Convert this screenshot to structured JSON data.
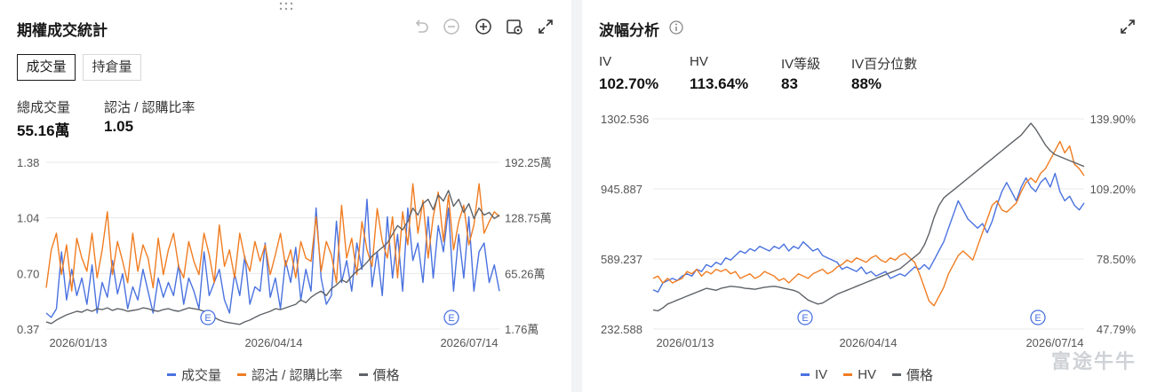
{
  "left": {
    "title": "期權成交統計",
    "tabs": [
      {
        "label": "成交量",
        "active": true
      },
      {
        "label": "持倉量",
        "active": false
      }
    ],
    "stats": [
      {
        "label": "總成交量",
        "value": "55.16萬"
      },
      {
        "label": "認沽 / 認購比率",
        "value": "1.05"
      }
    ],
    "toolbar_icons": [
      "undo-icon",
      "zoom-out-icon",
      "zoom-in-icon",
      "settings-icon",
      "expand-icon"
    ],
    "legend": [
      {
        "label": "成交量",
        "color": "#4a72e0"
      },
      {
        "label": "認沽 / 認購比率",
        "color": "#f07d22"
      },
      {
        "label": "價格",
        "color": "#5f6368"
      }
    ]
  },
  "right": {
    "title": "波幅分析",
    "metrics": [
      {
        "label": "IV",
        "value": "102.70%"
      },
      {
        "label": "HV",
        "value": "113.64%"
      },
      {
        "label": "IV等級",
        "value": "83"
      },
      {
        "label": "IV百分位數",
        "value": "88%"
      }
    ],
    "legend": [
      {
        "label": "IV",
        "color": "#4a72e0"
      },
      {
        "label": "HV",
        "color": "#f07d22"
      },
      {
        "label": "價格",
        "color": "#5f6368"
      }
    ],
    "watermark": "富途牛牛"
  },
  "chart_data": [
    {
      "type": "line",
      "title": "期權成交統計",
      "left_axis_ticks": [
        "1.38",
        "1.04",
        "0.70",
        "0.37"
      ],
      "right_axis_ticks": [
        "192.25萬",
        "128.75萬",
        "65.26萬",
        "1.76萬"
      ],
      "x_ticks": [
        "2026/01/13",
        "2026/04/14",
        "2026/07/14"
      ],
      "event_markers": [
        "E",
        "E"
      ],
      "ylim_left": [
        0.37,
        1.38
      ],
      "ylim_right": [
        1.76,
        192.25
      ],
      "series": [
        {
          "name": "成交量",
          "axis": "right",
          "color": "#4a72e0",
          "values": [
            20,
            15,
            25,
            90,
            35,
            70,
            40,
            60,
            30,
            75,
            20,
            55,
            38,
            80,
            42,
            65,
            25,
            50,
            35,
            70,
            45,
            20,
            60,
            38,
            55,
            40,
            75,
            30,
            60,
            45,
            25,
            90,
            40,
            55,
            70,
            35,
            20,
            65,
            40,
            85,
            30,
            50,
            45,
            100,
            38,
            60,
            25,
            80,
            55,
            95,
            35,
            70,
            45,
            140,
            60,
            30,
            40,
            125,
            55,
            80,
            45,
            100,
            70,
            150,
            50,
            90,
            40,
            130,
            60,
            110,
            45,
            140,
            80,
            100,
            55,
            130,
            60,
            120,
            90,
            140,
            45,
            110,
            60,
            130,
            45,
            90,
            100,
            55,
            75,
            45
          ]
        },
        {
          "name": "認沽 / 認購比率",
          "axis": "left",
          "color": "#f07d22",
          "values": [
            0.62,
            0.85,
            0.95,
            0.7,
            0.88,
            0.6,
            0.92,
            0.8,
            0.72,
            0.95,
            0.68,
            0.85,
            1.08,
            0.7,
            0.9,
            0.78,
            0.65,
            0.95,
            0.72,
            0.88,
            0.8,
            0.62,
            0.92,
            0.7,
            0.85,
            0.95,
            0.75,
            0.68,
            0.9,
            0.78,
            0.7,
            0.95,
            0.82,
            0.65,
            1.0,
            0.75,
            0.85,
            0.68,
            0.95,
            0.8,
            0.72,
            0.9,
            0.78,
            0.88,
            0.7,
            0.82,
            0.95,
            0.75,
            0.85,
            0.68,
            0.9,
            0.8,
            0.78,
            1.05,
            0.72,
            0.9,
            0.82,
            0.65,
            1.12,
            0.8,
            0.92,
            0.7,
            1.02,
            0.85,
            0.75,
            1.1,
            0.9,
            0.8,
            1.05,
            0.68,
            1.08,
            0.88,
            1.25,
            0.95,
            1.15,
            0.8,
            1.05,
            1.2,
            0.9,
            1.18,
            0.85,
            1.02,
            1.12,
            0.88,
            1.0,
            1.25,
            0.95,
            1.02,
            1.08,
            1.05
          ]
        },
        {
          "name": "價格",
          "axis": "right",
          "color": "#5f6368",
          "values": [
            10,
            8,
            12,
            15,
            18,
            20,
            22,
            21,
            24,
            22,
            25,
            24,
            26,
            23,
            25,
            24,
            22,
            23,
            24,
            26,
            25,
            23,
            22,
            24,
            25,
            23,
            22,
            24,
            26,
            25,
            24,
            22,
            18,
            15,
            12,
            10,
            9,
            8,
            7,
            10,
            12,
            15,
            18,
            20,
            22,
            25,
            24,
            26,
            28,
            30,
            35,
            32,
            38,
            42,
            45,
            40,
            48,
            52,
            58,
            55,
            62,
            68,
            72,
            78,
            85,
            90,
            95,
            100,
            110,
            120,
            115,
            125,
            140,
            132,
            145,
            150,
            138,
            155,
            148,
            160,
            142,
            150,
            135,
            145,
            128,
            140,
            132,
            135,
            128,
            132
          ]
        }
      ]
    },
    {
      "type": "line",
      "title": "波幅分析",
      "left_axis_ticks": [
        "1302.536",
        "945.887",
        "589.237",
        "232.588"
      ],
      "right_axis_ticks": [
        "139.90%",
        "109.20%",
        "78.50%",
        "47.79%"
      ],
      "x_ticks": [
        "2026/01/13",
        "2026/04/14",
        "2026/07/14"
      ],
      "event_markers": [
        "E",
        "E"
      ],
      "ylim_left": [
        232.588,
        1302.536
      ],
      "ylim_right": [
        47.79,
        139.9
      ],
      "series": [
        {
          "name": "IV",
          "axis": "right",
          "color": "#4a72e0",
          "values": [
            65,
            64,
            68,
            69,
            70,
            69,
            71,
            72,
            71,
            74,
            73,
            76,
            75,
            77,
            76,
            79,
            78,
            80,
            82,
            81,
            83,
            82,
            84,
            83,
            82,
            84,
            83,
            85,
            82,
            84,
            83,
            86,
            84,
            82,
            83,
            80,
            79,
            78,
            77,
            74,
            75,
            74,
            73,
            75,
            72,
            73,
            71,
            72,
            73,
            70,
            71,
            72,
            71,
            73,
            75,
            74,
            76,
            74,
            78,
            82,
            86,
            92,
            98,
            104,
            100,
            96,
            94,
            92,
            94,
            90,
            95,
            102,
            108,
            112,
            108,
            104,
            110,
            114,
            110,
            108,
            112,
            114,
            110,
            116,
            108,
            104,
            106,
            102,
            100,
            103
          ]
        },
        {
          "name": "HV",
          "axis": "right",
          "color": "#f07d22",
          "values": [
            70,
            71,
            68,
            70,
            68,
            69,
            70,
            73,
            72,
            74,
            71,
            73,
            72,
            74,
            73,
            74,
            72,
            73,
            70,
            71,
            72,
            70,
            71,
            73,
            72,
            71,
            69,
            70,
            68,
            70,
            72,
            71,
            70,
            72,
            73,
            74,
            72,
            73,
            75,
            76,
            78,
            77,
            79,
            78,
            77,
            79,
            80,
            78,
            77,
            79,
            78,
            80,
            81,
            79,
            77,
            72,
            66,
            60,
            58,
            62,
            66,
            72,
            76,
            80,
            82,
            80,
            78,
            84,
            90,
            96,
            102,
            104,
            100,
            99,
            101,
            103,
            108,
            112,
            114,
            112,
            116,
            118,
            122,
            126,
            130,
            125,
            128,
            120,
            118,
            115
          ]
        },
        {
          "name": "價格",
          "axis": "left",
          "color": "#5f6368",
          "values": [
            330,
            325,
            340,
            360,
            370,
            380,
            390,
            400,
            410,
            420,
            430,
            440,
            435,
            430,
            440,
            445,
            450,
            448,
            445,
            440,
            438,
            435,
            440,
            445,
            448,
            450,
            446,
            440,
            435,
            430,
            420,
            400,
            380,
            370,
            360,
            365,
            380,
            395,
            410,
            420,
            430,
            440,
            450,
            460,
            470,
            480,
            490,
            500,
            510,
            520,
            530,
            540,
            560,
            580,
            600,
            620,
            660,
            720,
            800,
            860,
            900,
            920,
            940,
            960,
            980,
            1000,
            1020,
            1040,
            1060,
            1080,
            1100,
            1120,
            1140,
            1160,
            1180,
            1200,
            1220,
            1250,
            1280,
            1250,
            1210,
            1170,
            1140,
            1120,
            1110,
            1100,
            1090,
            1080,
            1070,
            1060
          ]
        }
      ]
    }
  ]
}
